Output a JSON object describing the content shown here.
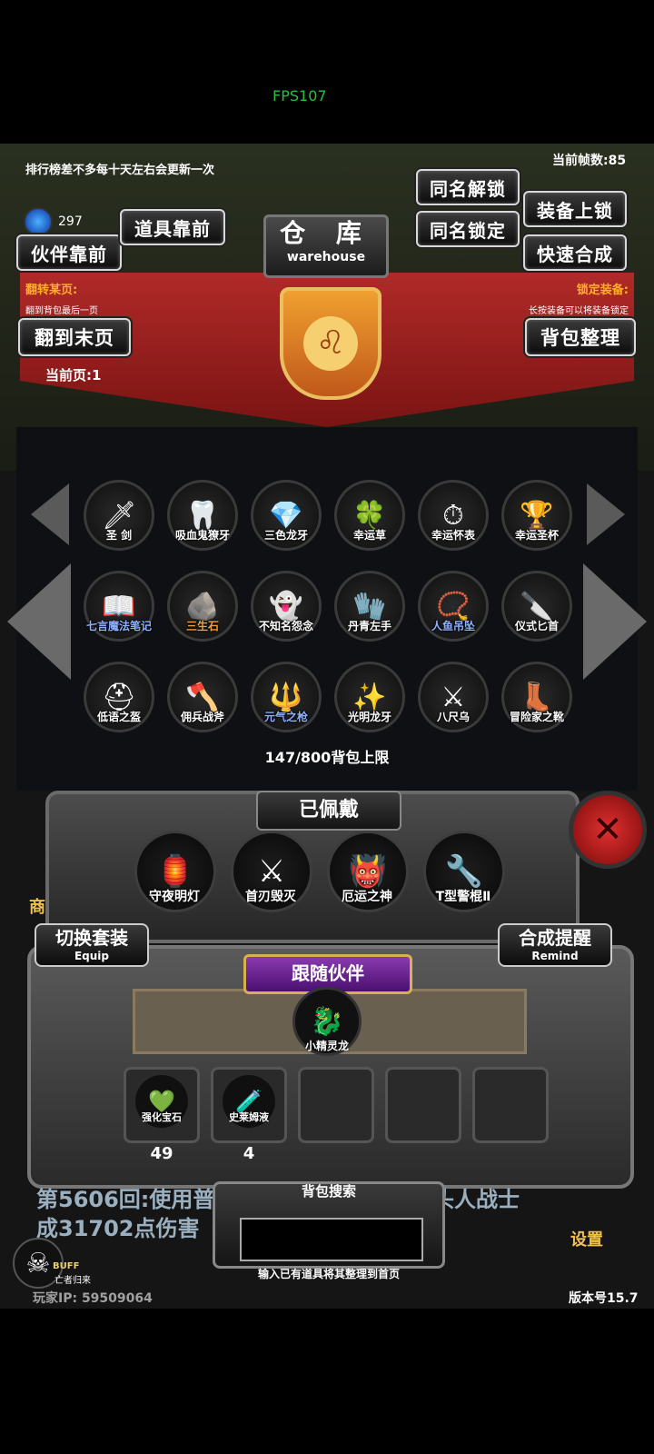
{
  "fps": "FPS107",
  "notice": "排行榜差不多每十天左右会更新一次",
  "frame_count": "当前帧数:85",
  "gem_count": "297",
  "buttons": {
    "partner_front": "伙伴靠前",
    "item_front": "道具靠前",
    "same_unlock": "同名解锁",
    "same_lock": "同名锁定",
    "equip_lock": "装备上锁",
    "quick_merge": "快速合成",
    "goto_last": "翻到末页",
    "sort_bag": "背包整理"
  },
  "warehouse": {
    "title_cn": "仓 库",
    "title_en": "warehouse"
  },
  "hints": {
    "left_title": "翻转某页:",
    "left_sub": "翻到背包最后一页",
    "right_title": "锁定装备:",
    "right_sub": "长按装备可以将装备锁定"
  },
  "current_page": "当前页:1",
  "items": [
    {
      "name": "圣 剑",
      "icon": "🗡",
      "color": "#ffffff"
    },
    {
      "name": "吸血鬼獠牙",
      "icon": "🦷",
      "color": "#ffffff"
    },
    {
      "name": "三色龙牙",
      "icon": "💎",
      "color": "#ffffff"
    },
    {
      "name": "幸运草",
      "icon": "🍀",
      "color": "#ffffff"
    },
    {
      "name": "幸运怀表",
      "icon": "⏱",
      "color": "#ffffff"
    },
    {
      "name": "幸运圣杯",
      "icon": "🏆",
      "color": "#ffffff"
    },
    {
      "name": "七言魔法笔记",
      "icon": "📖",
      "color": "#8fb0ff"
    },
    {
      "name": "三生石",
      "icon": "🪨",
      "color": "#f0a040"
    },
    {
      "name": "不知名怨念",
      "icon": "👻",
      "color": "#ffffff"
    },
    {
      "name": "丹青左手",
      "icon": "🧤",
      "color": "#ffffff"
    },
    {
      "name": "人鱼吊坠",
      "icon": "📿",
      "color": "#8fb0ff"
    },
    {
      "name": "仪式匕首",
      "icon": "🔪",
      "color": "#ffffff"
    },
    {
      "name": "低语之盔",
      "icon": "⛑",
      "color": "#ffffff"
    },
    {
      "name": "佣兵战斧",
      "icon": "🪓",
      "color": "#ffffff"
    },
    {
      "name": "元气之枪",
      "icon": "🔱",
      "color": "#8fb0ff"
    },
    {
      "name": "光明龙牙",
      "icon": "✨",
      "color": "#ffffff"
    },
    {
      "name": "八尺乌",
      "icon": "⚔",
      "color": "#ffffff"
    },
    {
      "name": "冒险家之靴",
      "icon": "👢",
      "color": "#ffffff"
    }
  ],
  "capacity": "147/800背包上限",
  "equipped_title": "已佩戴",
  "equipped": [
    {
      "name": "守夜明灯",
      "icon": "🏮"
    },
    {
      "name": "首刃毁灭",
      "icon": "⚔"
    },
    {
      "name": "厄运之神",
      "icon": "👹"
    },
    {
      "name": "T型警棍Ⅱ",
      "icon": "🔧"
    }
  ],
  "switch_suit": {
    "label": "切换套装",
    "sub": "Equip"
  },
  "merge_remind": {
    "label": "合成提醒",
    "sub": "Remind"
  },
  "follow_partner": "跟随伙伴",
  "pet": {
    "name": "小精灵龙",
    "icon": "🐉"
  },
  "consumables": [
    {
      "name": "强化宝石",
      "icon": "💚",
      "count": "49"
    },
    {
      "name": "史莱姆液",
      "icon": "🧪",
      "count": "4"
    }
  ],
  "log_line1": "第5606回:使用普",
  "log_line1_tail": "头人战士",
  "log_line2": "成31702点伤害",
  "bag_search": {
    "title": "背包搜索",
    "placeholder": "",
    "hint": "输入已有道具将其整理到首页"
  },
  "buff": {
    "label": "BUFF",
    "sub": "亡者归来"
  },
  "player_ip": "玩家IP:  59509064",
  "version": "版本号15.7",
  "settings": "设置",
  "shop": "商"
}
